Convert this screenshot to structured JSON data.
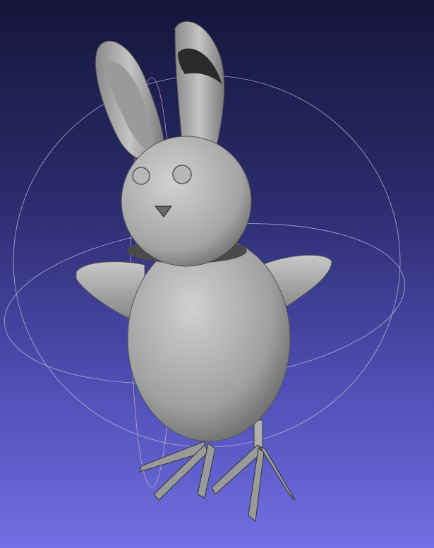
{
  "viewport": {
    "background_top": "#15153a",
    "background_bottom": "#7070e2",
    "mesh_color": "#a8a8a8",
    "trackball_color": "#c8c8e8"
  }
}
